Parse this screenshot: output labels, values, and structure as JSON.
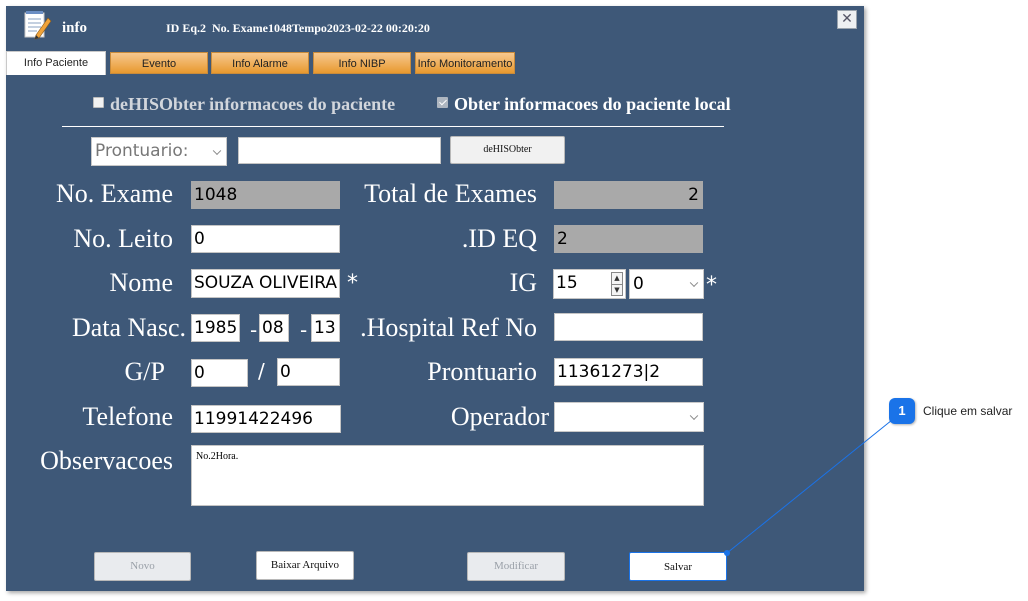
{
  "window": {
    "title": "info",
    "id_eq_label": "ID Eq.2",
    "exam_info": "No. Exame1048Tempo2023-02-22 00:20:20",
    "close_symbol": "✕"
  },
  "tabs": [
    "Info Paciente",
    "Evento",
    "Info Alarme",
    "Info NIBP",
    "Info Monitoramento"
  ],
  "options": {
    "his_label": "deHISObter informacoes do paciente",
    "local_label": "Obter informacoes do paciente local"
  },
  "his_search": {
    "select_value": "Prontuario:",
    "input_value": "",
    "button_label": "deHISObter"
  },
  "form": {
    "exam_no_label": "No. Exame",
    "exam_no_value": "1048",
    "total_exams_label": "Total de Exames",
    "total_exams_value": "2",
    "bed_no_label": "No. Leito",
    "bed_no_value": "0",
    "id_eq_label": ".ID EQ",
    "id_eq_value": "2",
    "name_label": "Nome",
    "name_value": "SOUZA OLIVEIRA",
    "required_mark": "*",
    "ig_label": "IG",
    "ig_value": "15",
    "ig_select_value": "0",
    "birth_label": "Data Nasc.",
    "birth_year": "1985",
    "birth_month": "08",
    "birth_day": "13",
    "date_sep": "-",
    "hospital_ref_label": ".Hospital Ref No",
    "hospital_ref_value": "",
    "gp_label": "G/P",
    "g_value": "0",
    "gp_sep": "/",
    "p_value": "0",
    "prontuario_label": "Prontuario",
    "prontuario_value": "11361273|2",
    "phone_label": "Telefone",
    "phone_value": "11991422496",
    "operator_label": "Operador",
    "operator_value": "",
    "notes_label": "Observacoes",
    "notes_value": "No.2Hora."
  },
  "buttons": {
    "novo": "Novo",
    "baixar": "Baixar Arquivo",
    "modificar": "Modificar",
    "salvar": "Salvar"
  },
  "callout": {
    "number": "1",
    "text": "Clique em salvar",
    "color": "#1a73e8"
  },
  "colors": {
    "window_bg": "#3e5878",
    "tab_orange": "#e8992f",
    "readonly_field": "#a9a9a9"
  }
}
